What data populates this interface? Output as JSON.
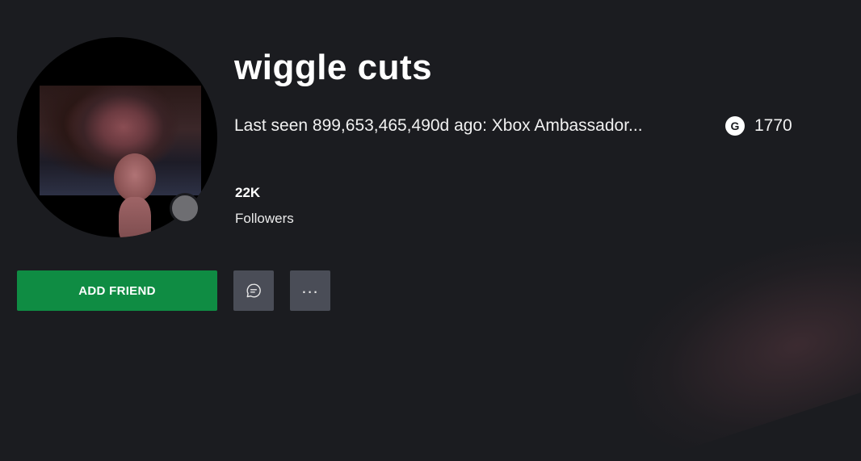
{
  "profile": {
    "gamertag": "wiggle cuts",
    "status": "Last seen 899,653,465,490d ago: Xbox Ambassador...",
    "gamerscore_icon": "G",
    "gamerscore": "1770",
    "followers_count": "22K",
    "followers_label": "Followers",
    "presence_color": "#6e6e72"
  },
  "actions": {
    "add_friend_label": "ADD FRIEND",
    "add_friend_color": "#0f8c43",
    "message_icon": "chat-bubble-icon",
    "more_icon_glyph": "..."
  }
}
